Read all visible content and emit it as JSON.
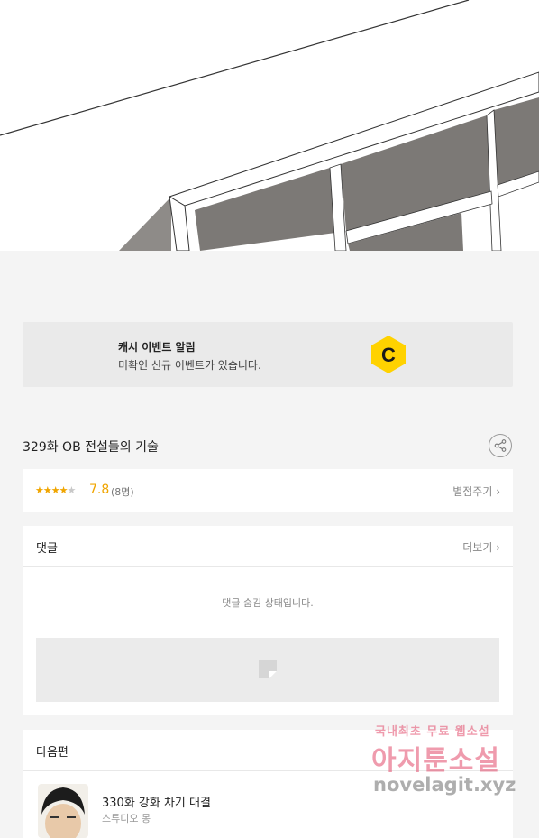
{
  "cash_banner": {
    "title": "캐시 이벤트 알림",
    "subtitle": "미확인 신규 이벤트가 있습니다.",
    "logo_letter": "C"
  },
  "episode": {
    "title": "329화 OB 전설들의 기술"
  },
  "rating": {
    "stars_filled": 4,
    "stars_total": 5,
    "score": "7.8",
    "count": "(8명)",
    "action": "별점주기 ›"
  },
  "comments": {
    "title": "댓글",
    "more": "더보기 ›",
    "hidden_message": "댓글 숨김 상태입니다."
  },
  "next_episode": {
    "section_title": "다음편",
    "title": "330화 강화 차기 대결",
    "subtitle": "스튜디오 몽"
  },
  "watermark": {
    "line1": "국내최초 무료 웹소설",
    "line2": "아지툰소설",
    "line3": "novelagit.xyz"
  },
  "colors": {
    "accent_star": "#f0a500",
    "cash_logo": "#ffd200",
    "watermark_pink": "#e24b6b"
  },
  "icons": {
    "share": "share-icon",
    "cash": "cash-c-icon",
    "ad": "ad-placeholder-icon"
  }
}
